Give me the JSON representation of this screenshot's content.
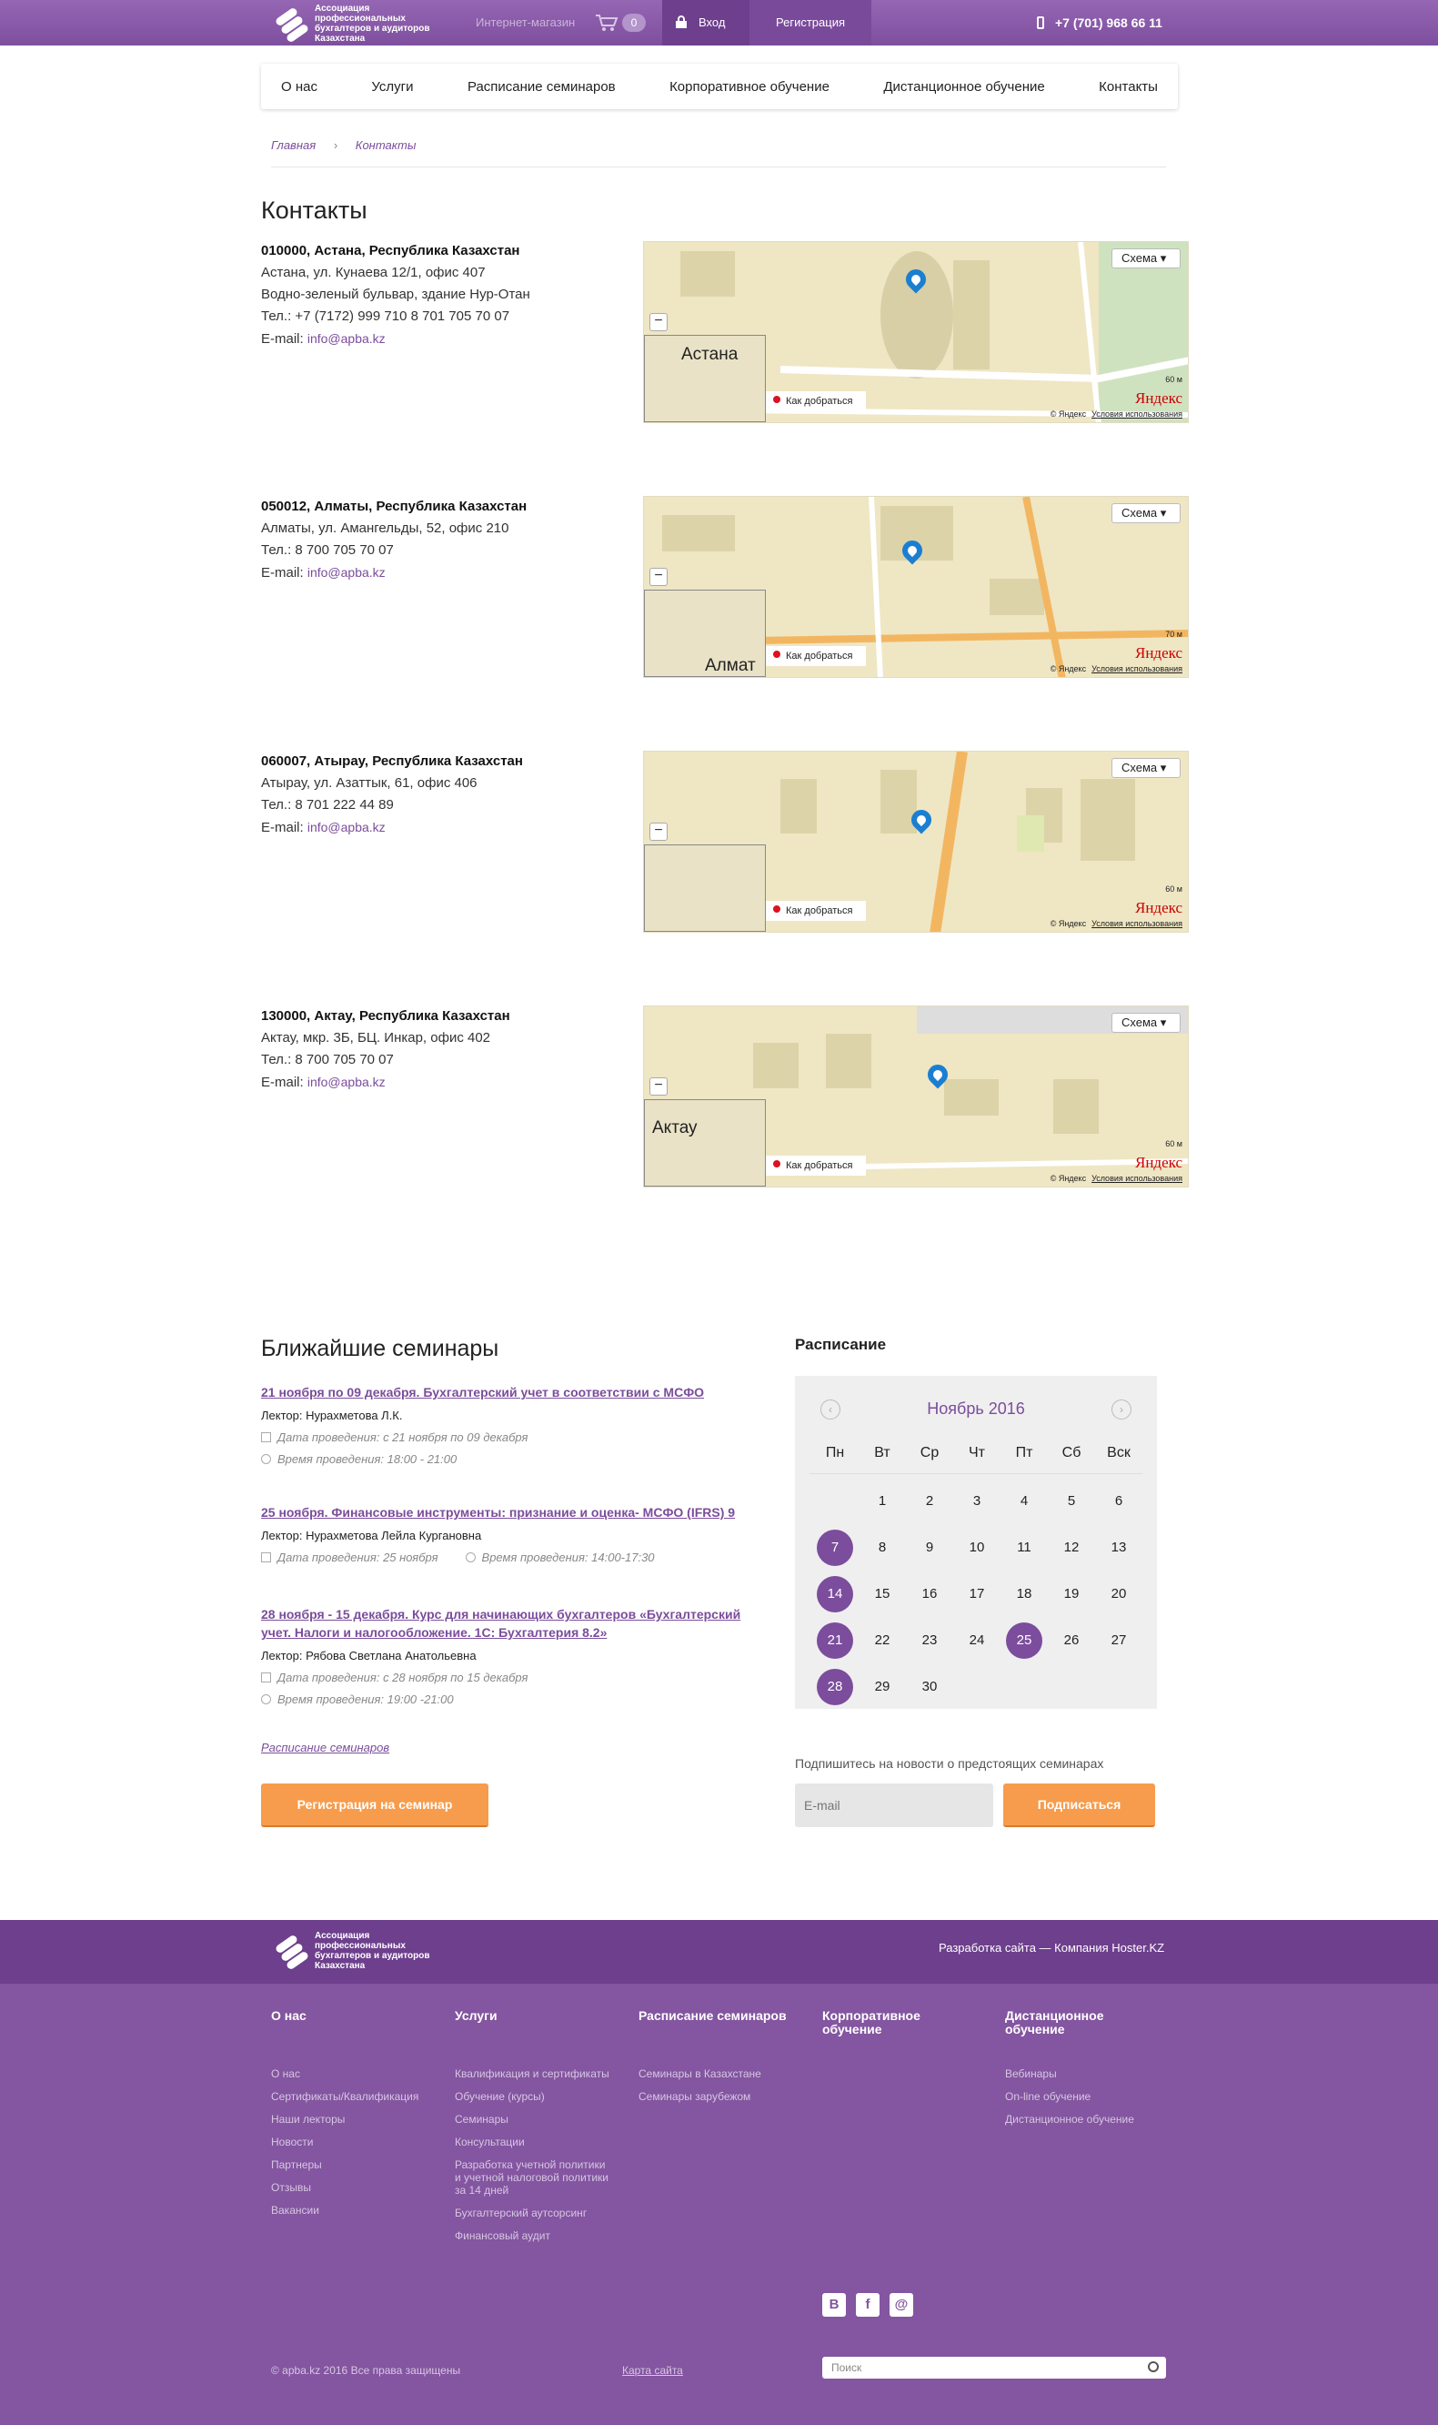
{
  "header": {
    "logo_text": "Ассоциация профессиональных бухгалтеров и аудиторов Казахстана",
    "shop": "Интернет-магазин",
    "cart_count": "0",
    "login": "Вход",
    "register": "Регистрация",
    "phone": "+7 (701) 968 66 11"
  },
  "nav": [
    "О нас",
    "Услуги",
    "Расписание семинаров",
    "Корпоративное обучение",
    "Дистанционное обучение",
    "Контакты"
  ],
  "breadcrumb": {
    "home": "Главная",
    "sep": "›",
    "current": "Контакты"
  },
  "page_title": "Контакты",
  "offices": [
    {
      "head": "010000, Астана, Республика Казахстан",
      "lines": [
        "Астана, ул. Кунаева 12/1, офис 407",
        "Водно-зеленый бульвар, здание Нур-Отан",
        "Тел.:   +7 (7172) 999 710  8 701 705 70 07"
      ],
      "email_label": "E-mail: ",
      "email": "info@apba.kz",
      "map_city": "Астана"
    },
    {
      "head": "050012, Алматы, Республика Казахстан",
      "lines": [
        "Алматы, ул. Амангельды, 52, офис 210",
        "Тел.: 8 700 705 70 07"
      ],
      "email_label": "E-mail: ",
      "email": "info@apba.kz",
      "map_city": "Алмат"
    },
    {
      "head": "060007, Атырау, Республика Казахстан",
      "lines": [
        "Атырау, ул. Азаттык, 61, офис 406",
        "Тел.: 8 701 222 44 89"
      ],
      "email_label": "E-mail: ",
      "email": "info@apba.kz",
      "map_city": ""
    },
    {
      "head": "130000, Актау, Республика Казахстан",
      "lines": [
        "Актау, мкр. 3Б, БЦ. Инкар, офис 402",
        "Тел.: 8 700 705 70 07"
      ],
      "email_label": "E-mail: ",
      "email": "info@apba.kz",
      "map_city": "Актау"
    }
  ],
  "map_ui": {
    "schema": "Схема ▾",
    "route": "Как добраться",
    "yandex": "Яндекс",
    "terms_a": "© Яндекс",
    "terms_b": "Условия использования",
    "scales": [
      "60 м",
      "70 м",
      "60 м",
      "60 м"
    ]
  },
  "seminars": {
    "title": "Ближайшие семинары",
    "items": [
      {
        "link": "21 ноября по 09 декабря. Бухгалтерский учет в соответствии с МСФО",
        "lecturer": "Лектор: Нурахметова Л.К.",
        "date": "Дата проведения: с 21 ноября по 09 декабря",
        "time": "Время проведения: 18:00 - 21:00"
      },
      {
        "link": "25 ноября. Финансовые инструменты: признание и оценка- МСФО (IFRS) 9",
        "lecturer": "Лектор: Нурахметова Лейла Кургановна",
        "date": "Дата проведения: 25 ноября",
        "time": "Время проведения: 14:00-17:30"
      },
      {
        "link": "28 ноября - 15 декабря. Курс для начинающих бухгалтеров «Бухгалтерский учет. Налоги и налогообложение. 1С: Бухгалтерия 8.2»",
        "lecturer": "Лектор: Рябова Светлана Анатольевна",
        "date": "Дата проведения: с 28 ноября по 15 декабря",
        "time": "Время проведения: 19:00 -21:00"
      }
    ],
    "all_link": "Расписание семинаров",
    "register_button": "Регистрация на семинар"
  },
  "schedule": {
    "title": "Расписание",
    "month": "Ноябрь 2016",
    "weekdays": [
      "Пн",
      "Вт",
      "Ср",
      "Чт",
      "Пт",
      "Сб",
      "Вск"
    ],
    "weeks": [
      [
        "",
        "1",
        "2",
        "3",
        "4",
        "5",
        "6"
      ],
      [
        "7",
        "8",
        "9",
        "10",
        "11",
        "12",
        "13"
      ],
      [
        "14",
        "15",
        "16",
        "17",
        "18",
        "19",
        "20"
      ],
      [
        "21",
        "22",
        "23",
        "24",
        "25",
        "26",
        "27"
      ],
      [
        "28",
        "29",
        "30",
        "",
        "",
        "",
        ""
      ]
    ],
    "highlighted": [
      "7",
      "14",
      "21",
      "25",
      "28"
    ]
  },
  "subscribe": {
    "label": "Подпишитесь на новости о предстоящих семинарах",
    "placeholder": "E-mail",
    "button": "Подписаться"
  },
  "footer": {
    "developer": "Разработка сайта — Компания Hoster.KZ",
    "columns": [
      {
        "title": "О нас",
        "links": [
          "О нас",
          "Сертификаты/Квалификация",
          "Наши лекторы",
          "Новости",
          "Партнеры",
          "Отзывы",
          "Вакансии"
        ]
      },
      {
        "title": "Услуги",
        "links": [
          "Квалификация и сертификаты",
          "Обучение (курсы)",
          "Семинары",
          "Консультации",
          "Разработка учетной политики и учетной налоговой политики за 14 дней",
          "Бухгалтерский аутсорсинг",
          "Финансовый аудит"
        ]
      },
      {
        "title": "Расписание семинаров",
        "links": [
          "Семинары в Казахстане",
          "Семинары зарубежом"
        ]
      },
      {
        "title": "Корпоративное обучение",
        "links": []
      },
      {
        "title": "Дистанционное обучение",
        "links": [
          "Вебинары",
          "On-line обучение",
          "Дистанционное обучение"
        ]
      }
    ],
    "social": [
      "В",
      "f",
      "@"
    ],
    "copyright": "© apba.kz 2016 Все права защищены",
    "sitemap": "Карта сайта",
    "search_placeholder": "Поиск"
  },
  "colors": {
    "brand": "#7b4d9c",
    "accent": "#f79c4c",
    "footer": "#8455a0"
  }
}
